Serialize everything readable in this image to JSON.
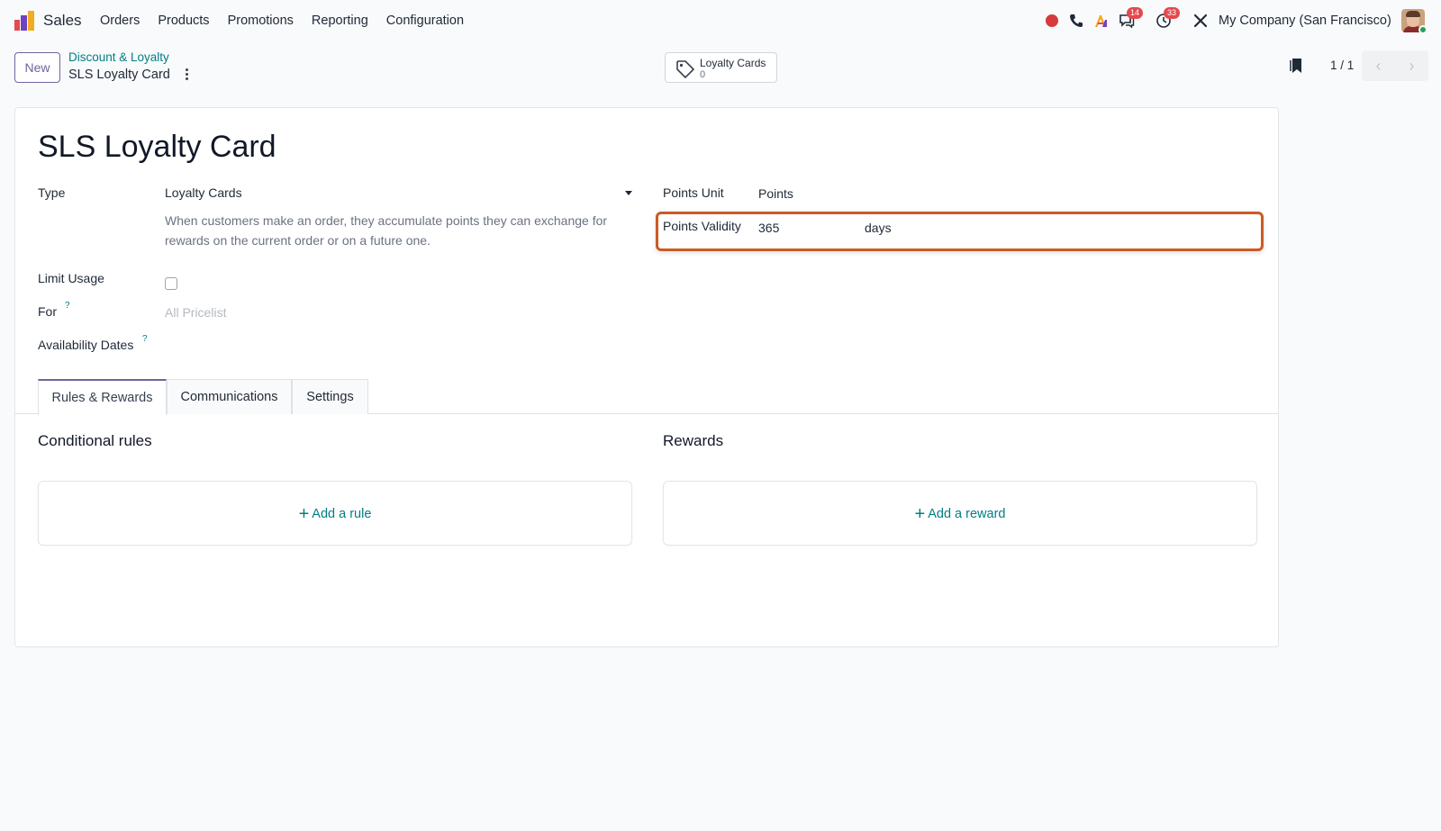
{
  "navbar": {
    "app_name": "Sales",
    "menu": [
      "Orders",
      "Products",
      "Promotions",
      "Reporting",
      "Configuration"
    ],
    "messages_badge": "14",
    "activities_badge": "33",
    "company": "My Company (San Francisco)",
    "icons": [
      "record-icon",
      "phone-icon",
      "ai-icon",
      "chat-icon",
      "clock-icon",
      "tools-icon"
    ]
  },
  "control_panel": {
    "new_label": "New",
    "breadcrumb_parent": "Discount & Loyalty",
    "breadcrumb_current": "SLS Loyalty Card",
    "smart_button": {
      "label": "Loyalty Cards",
      "count": "0"
    },
    "pager_value": "1 / 1"
  },
  "form": {
    "title": "SLS Loyalty Card",
    "type_label": "Type",
    "type_value": "Loyalty Cards",
    "type_description": "When customers make an order, they accumulate points they can exchange for rewards on the current order or on a future one.",
    "limit_usage_label": "Limit Usage",
    "limit_usage_checked": false,
    "for_label": "For",
    "for_placeholder": "All Pricelist",
    "availability_label": "Availability Dates",
    "help_mark": "?",
    "points_unit_label": "Points Unit",
    "points_unit_value": "Points",
    "points_validity_label": "Points Validity",
    "points_validity_value": "365",
    "points_validity_unit": "days"
  },
  "tabs": [
    "Rules & Rewards",
    "Communications",
    "Settings"
  ],
  "active_tab": "Rules & Rewards",
  "rules": {
    "title": "Conditional rules",
    "add_label": "Add a rule"
  },
  "rewards": {
    "title": "Rewards",
    "add_label": "Add a reward"
  },
  "colors": {
    "accent": "#71639e",
    "link": "#017e84",
    "highlight": "#cc5a26"
  }
}
